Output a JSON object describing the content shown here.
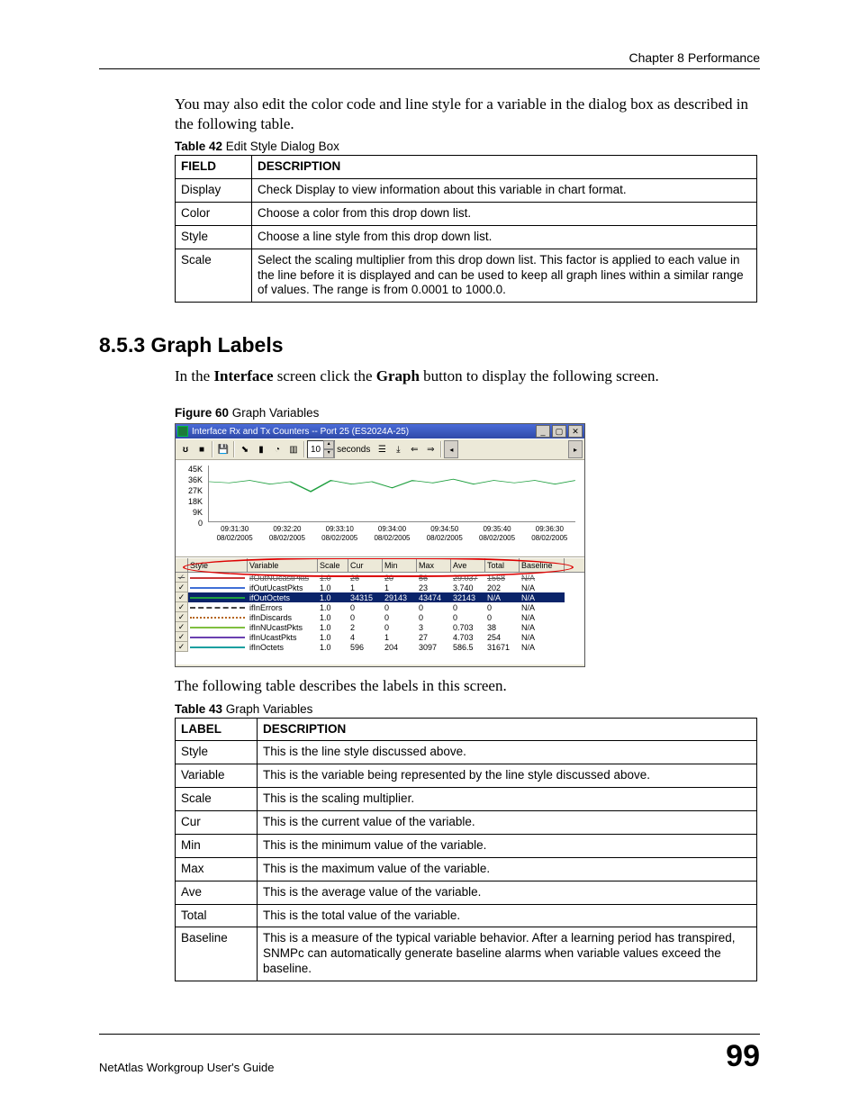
{
  "chapter_header": "Chapter 8 Performance",
  "intro_para": "You may also edit the color code and line style for a variable in the dialog box as described in the following table.",
  "table42": {
    "caption_bold": "Table 42",
    "caption_rest": "   Edit Style Dialog Box",
    "head_field": "FIELD",
    "head_desc": "DESCRIPTION",
    "rows": [
      {
        "f": "Display",
        "d": "Check Display to view information about this variable in chart format."
      },
      {
        "f": "Color",
        "d": "Choose a color from this drop down list."
      },
      {
        "f": "Style",
        "d": "Choose a line style from this drop down list."
      },
      {
        "f": "Scale",
        "d": "Select the scaling multiplier from this drop down list. This factor is applied to each value in the line before it is displayed and can be used to keep all graph lines within a similar range of values. The range is from 0.0001 to 1000.0."
      }
    ]
  },
  "h2": "8.5.3  Graph Labels",
  "h2_para_pre": "In the ",
  "h2_para_b1": "Interface",
  "h2_para_mid": " screen click the ",
  "h2_para_b2": "Graph",
  "h2_para_post": " button to display the following screen.",
  "fig60": {
    "caption_bold": "Figure 60",
    "caption_rest": "   Graph Variables",
    "title": "Interface Rx and Tx Counters -- Port 25 (ES2024A-25)",
    "seconds_value": "10",
    "seconds_label": "seconds",
    "yticks": [
      "45K",
      "36K",
      "27K",
      "18K",
      "9K",
      "0"
    ],
    "xticks": [
      {
        "t": "09:31:30",
        "d": "08/02/2005"
      },
      {
        "t": "09:32:20",
        "d": "08/02/2005"
      },
      {
        "t": "09:33:10",
        "d": "08/02/2005"
      },
      {
        "t": "09:34:00",
        "d": "08/02/2005"
      },
      {
        "t": "09:34:50",
        "d": "08/02/2005"
      },
      {
        "t": "09:35:40",
        "d": "08/02/2005"
      },
      {
        "t": "09:36:30",
        "d": "08/02/2005"
      }
    ],
    "chart_data": {
      "type": "line",
      "yrange": [
        0,
        45000
      ],
      "series_plotted": "ifOutOctets",
      "values_k": [
        32,
        31,
        33,
        30,
        32,
        24,
        33,
        30,
        32,
        27,
        33,
        31,
        34,
        30,
        33,
        31,
        33,
        30,
        33
      ]
    },
    "grid_headers": {
      "style": "Style",
      "variable": "Variable",
      "scale": "Scale",
      "cur": "Cur",
      "min": "Min",
      "max": "Max",
      "ave": "Ave",
      "total": "Total",
      "baseline": "Baseline"
    },
    "grid_rows": [
      {
        "sel": false,
        "struck": true,
        "checked": true,
        "color": "#c93a3a",
        "pattern": "solid",
        "var": "ifOutNUcastPkts",
        "scale": "1.0",
        "cur": "26",
        "min": "20",
        "max": "56",
        "ave": "29.037",
        "total": "1568",
        "bl": "N/A"
      },
      {
        "sel": false,
        "struck": false,
        "checked": true,
        "color": "#406fd6",
        "pattern": "solid",
        "var": "ifOutUcastPkts",
        "scale": "1.0",
        "cur": "1",
        "min": "1",
        "max": "23",
        "ave": "3.740",
        "total": "202",
        "bl": "N/A"
      },
      {
        "sel": true,
        "struck": false,
        "checked": true,
        "color": "#20a040",
        "pattern": "solid",
        "var": "ifOutOctets",
        "scale": "1.0",
        "cur": "34315",
        "min": "29143",
        "max": "43474",
        "ave": "32143",
        "total": "N/A",
        "bl": "N/A"
      },
      {
        "sel": false,
        "struck": false,
        "checked": true,
        "color": "#444444",
        "pattern": "dashed",
        "var": "ifInErrors",
        "scale": "1.0",
        "cur": "0",
        "min": "0",
        "max": "0",
        "ave": "0",
        "total": "0",
        "bl": "N/A"
      },
      {
        "sel": false,
        "struck": false,
        "checked": true,
        "color": "#b5651d",
        "pattern": "dotted",
        "var": "ifInDiscards",
        "scale": "1.0",
        "cur": "0",
        "min": "0",
        "max": "0",
        "ave": "0",
        "total": "0",
        "bl": "N/A"
      },
      {
        "sel": false,
        "struck": false,
        "checked": true,
        "color": "#7fbf3f",
        "pattern": "solid",
        "var": "ifInNUcastPkts",
        "scale": "1.0",
        "cur": "2",
        "min": "0",
        "max": "3",
        "ave": "0.703",
        "total": "38",
        "bl": "N/A"
      },
      {
        "sel": false,
        "struck": false,
        "checked": true,
        "color": "#6a3fb0",
        "pattern": "solid",
        "var": "ifInUcastPkts",
        "scale": "1.0",
        "cur": "4",
        "min": "1",
        "max": "27",
        "ave": "4.703",
        "total": "254",
        "bl": "N/A"
      },
      {
        "sel": false,
        "struck": false,
        "checked": true,
        "color": "#1aa0a0",
        "pattern": "solid",
        "var": "ifInOctets",
        "scale": "1.0",
        "cur": "596",
        "min": "204",
        "max": "3097",
        "ave": "586.5",
        "total": "31671",
        "bl": "N/A"
      }
    ]
  },
  "after_fig_para": "The following table describes the labels in this screen.",
  "table43": {
    "caption_bold": "Table 43",
    "caption_rest": "   Graph Variables",
    "head_label": "LABEL",
    "head_desc": "DESCRIPTION",
    "rows": [
      {
        "l": "Style",
        "d": "This is the line style discussed above."
      },
      {
        "l": "Variable",
        "d": "This is the variable being represented by the line style discussed above."
      },
      {
        "l": "Scale",
        "d": "This is the scaling multiplier."
      },
      {
        "l": "Cur",
        "d": "This is the current value of the variable."
      },
      {
        "l": "Min",
        "d": "This is the minimum value of the variable."
      },
      {
        "l": "Max",
        "d": "This is the maximum value of the variable."
      },
      {
        "l": "Ave",
        "d": "This is the average value of the variable."
      },
      {
        "l": "Total",
        "d": "This is the total value of the variable."
      },
      {
        "l": "Baseline",
        "d": "This is a measure of the typical variable behavior. After a learning period has transpired, SNMPc can automatically generate baseline alarms when variable values exceed the baseline."
      }
    ]
  },
  "footer_guide": "NetAtlas Workgroup User's Guide",
  "footer_page": "99"
}
